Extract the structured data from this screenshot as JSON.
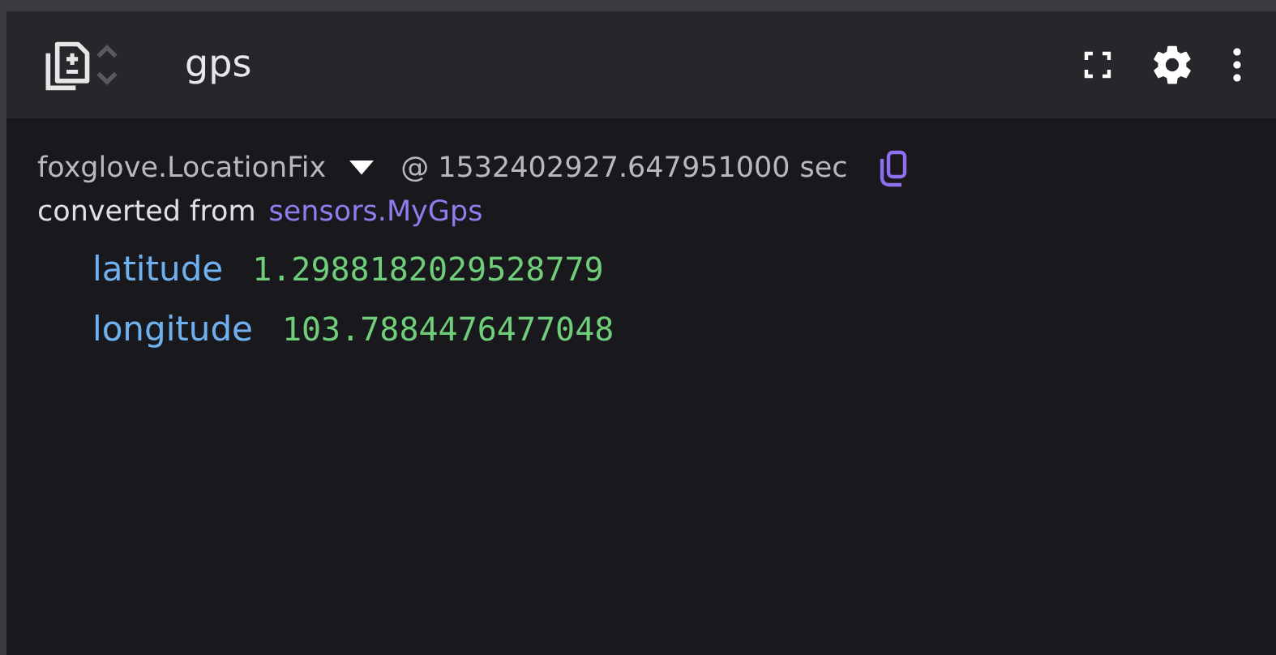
{
  "panel": {
    "title": "gps"
  },
  "message": {
    "schema": "foxglove.LocationFix",
    "timestamp": "@ 1532402927.647951000",
    "unit": "sec",
    "converted_label": "converted from",
    "source": "sensors.MyGps"
  },
  "fields": [
    {
      "key": "latitude",
      "value": "1.2988182029528779"
    },
    {
      "key": "longitude",
      "value": "103.7884476477048"
    }
  ]
}
